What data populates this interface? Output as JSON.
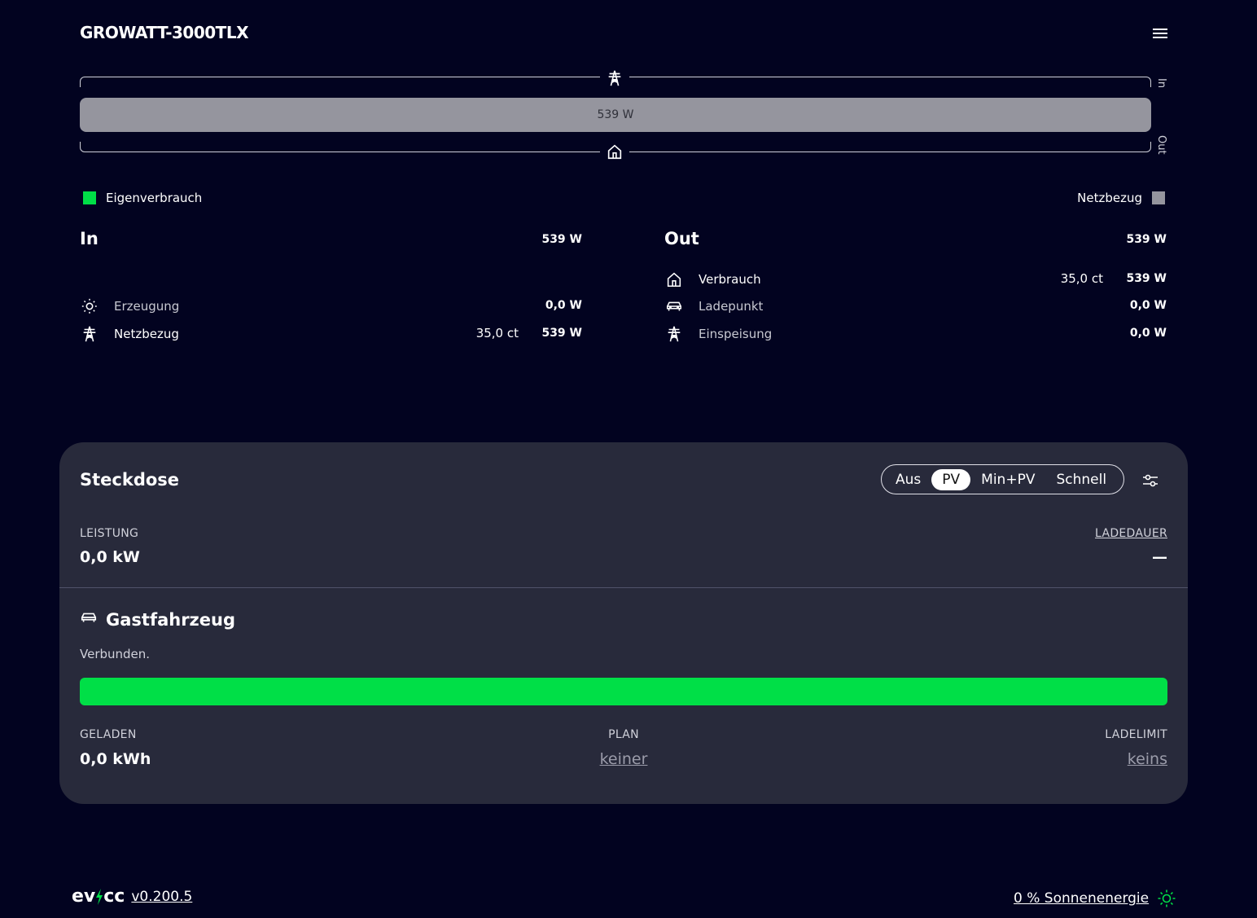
{
  "header": {
    "title": "GROWATT-3000TLX"
  },
  "flow": {
    "bar_value": "539 W",
    "in_label": "In",
    "out_label": "Out",
    "grid_import_fraction": 1.0
  },
  "legend": {
    "self_consumption": {
      "label": "Eigenverbrauch",
      "color": "#00df47"
    },
    "grid_import": {
      "label": "Netzbezug",
      "color": "#95959e"
    }
  },
  "in_section": {
    "title": "In",
    "total": "539 W",
    "rows": [
      {
        "label": "Erzeugung",
        "icon": "sun-icon",
        "price": "",
        "value": "0,0 W"
      },
      {
        "label": "Netzbezug",
        "icon": "power-tower-icon",
        "price": "35,0 ct",
        "value": "539 W"
      }
    ]
  },
  "out_section": {
    "title": "Out",
    "total": "539 W",
    "rows": [
      {
        "label": "Verbrauch",
        "icon": "home-icon",
        "price": "35,0 ct",
        "value": "539 W"
      },
      {
        "label": "Ladepunkt",
        "icon": "car-icon",
        "price": "",
        "value": "0,0 W"
      },
      {
        "label": "Einspeisung",
        "icon": "power-tower-icon",
        "price": "",
        "value": "0,0 W"
      }
    ]
  },
  "loadpoint": {
    "title": "Steckdose",
    "modes": [
      "Aus",
      "PV",
      "Min+PV",
      "Schnell"
    ],
    "active_mode": "PV",
    "power_label": "LEISTUNG",
    "power_value": "0,0 kW",
    "duration_label": "LADEDAUER",
    "duration_value": "—",
    "vehicle": {
      "name": "Gastfahrzeug",
      "status": "Verbunden.",
      "progress_fraction": 1.0,
      "charged_label": "GELADEN",
      "charged_value": "0,0 kWh",
      "plan_label": "PLAN",
      "plan_value": "keiner",
      "limit_label": "LADELIMIT",
      "limit_value": "keins"
    }
  },
  "footer": {
    "logo_left": "ev",
    "logo_right": "cc",
    "version": "v0.200.5",
    "solar": "0 % Sonnenenergie"
  },
  "colors": {
    "accent": "#00df47",
    "background": "#020320",
    "card": "#282a3b",
    "grid": "#95959e"
  }
}
